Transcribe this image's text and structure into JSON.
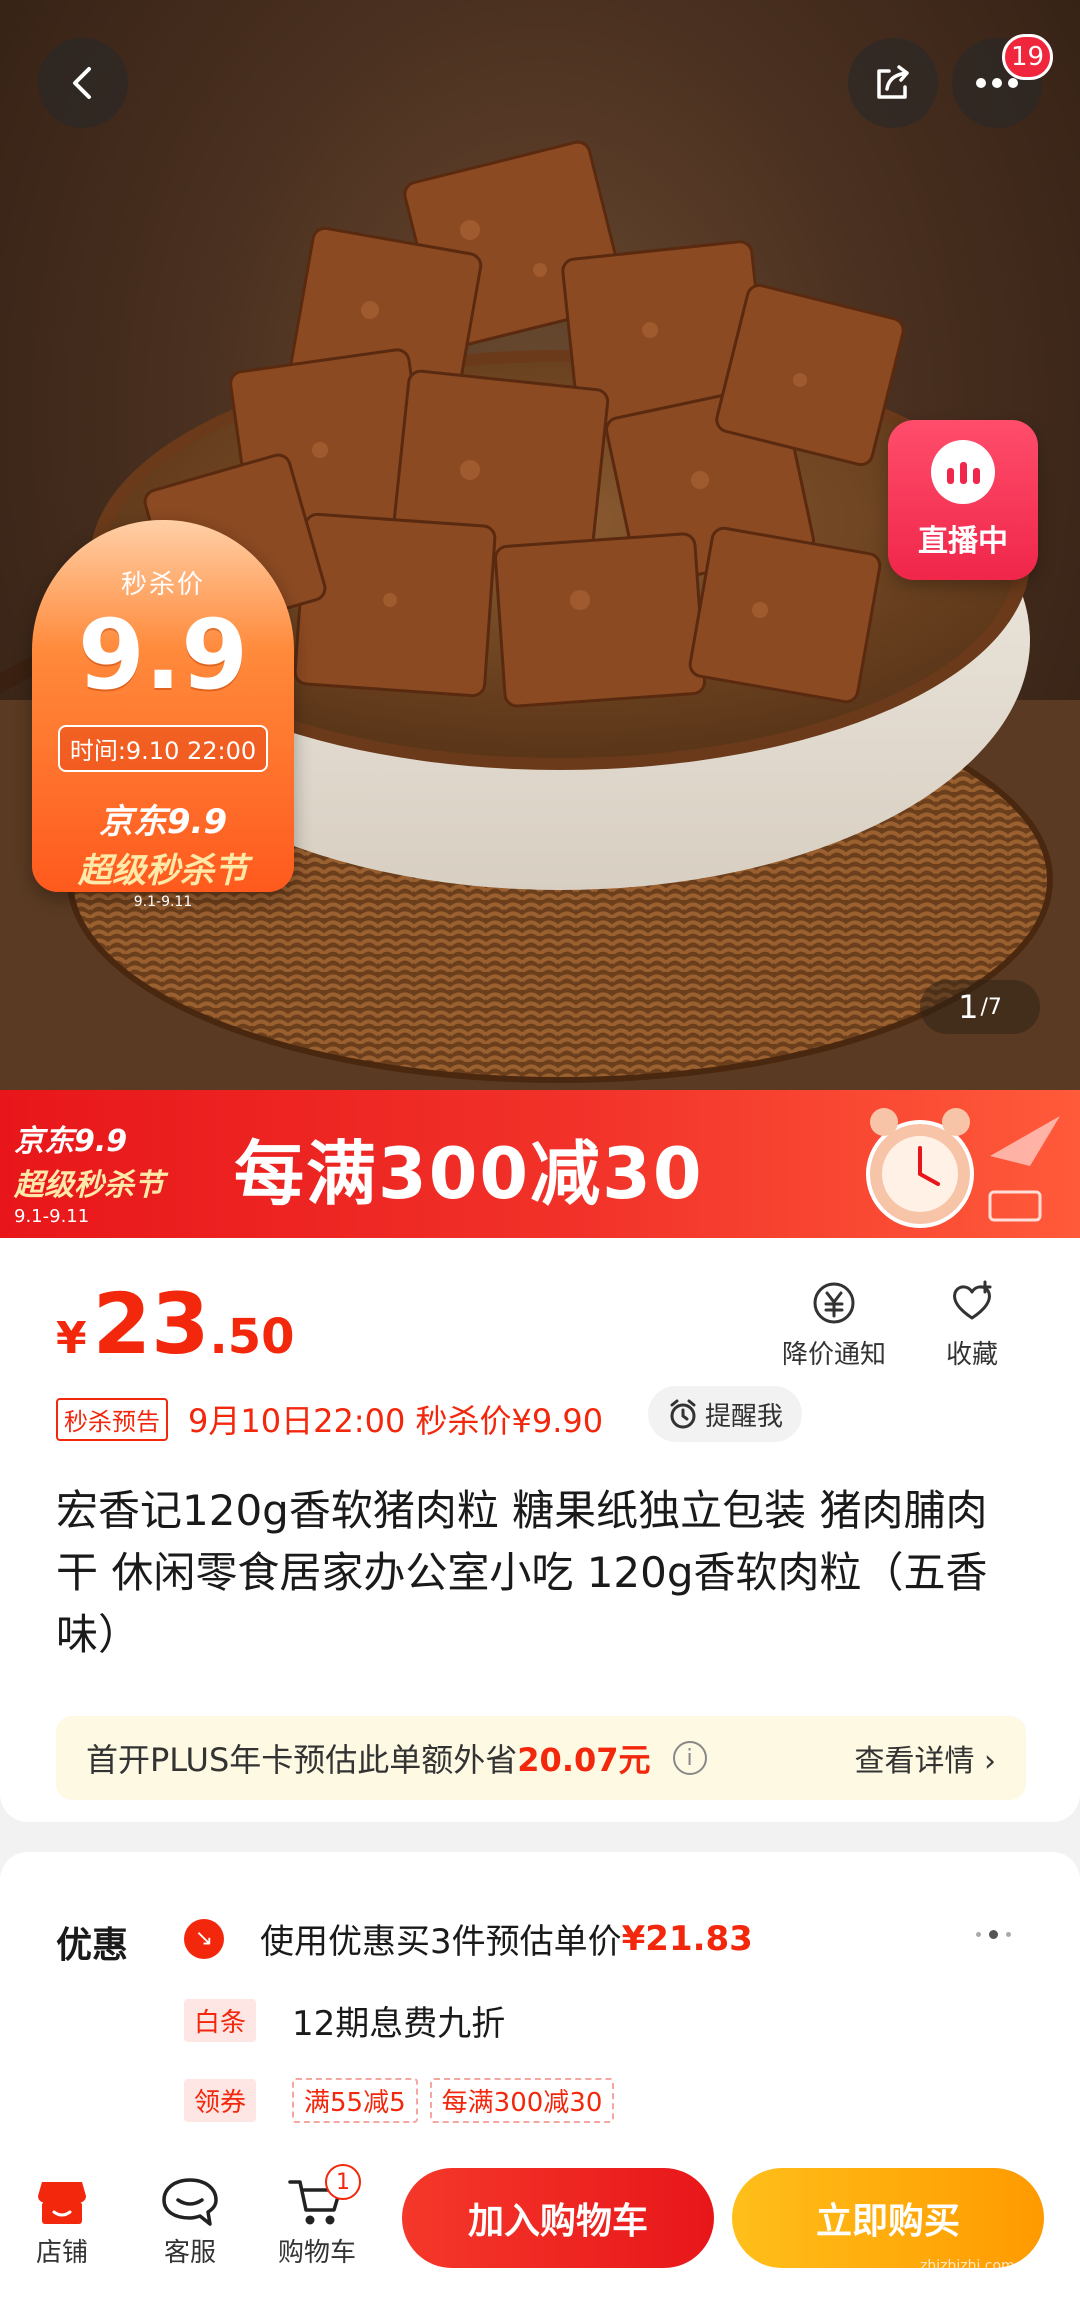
{
  "top_bar": {
    "notification_count": "19"
  },
  "hero": {
    "live_label": "直播中",
    "promo": {
      "label": "秒杀价",
      "price": "9.9",
      "time": "时间:9.10  22:00",
      "fest_line1": "京东9.9",
      "fest_line2": "超级秒杀节",
      "fest_dates": "9.1-9.11"
    },
    "image_index": "1",
    "image_total": "/7"
  },
  "banner": {
    "fest_line1": "京东9.9",
    "fest_line2": "超级秒杀节",
    "fest_dates": "9.1-9.11",
    "title": "每满300减30"
  },
  "product": {
    "currency": "¥",
    "price_int": "23",
    "price_dec": ".50",
    "price_alert_label": "降价通知",
    "favorite_label": "收藏",
    "preview_tag": "秒杀预告",
    "preview_text": "9月10日22:00 秒杀价¥9.90",
    "remind_label": "提醒我",
    "title": "宏香记120g香软猪肉粒 糖果纸独立包装 猪肉脯肉干 休闲零食居家办公室小吃 120g香软肉粒（五香味）",
    "plus_text": "首开PLUS年卡预估此单额外省",
    "plus_amount": "20.07元",
    "plus_detail": "查看详情 ›"
  },
  "offers": {
    "heading": "优惠",
    "row1_text": "使用优惠买3件预估单价",
    "row1_value": "¥21.83",
    "baitiao_tag": "白条",
    "baitiao_text": "12期息费九折",
    "coupon_tag": "领券",
    "coupons": [
      "满55减5",
      "每满300减30"
    ]
  },
  "bottom_bar": {
    "store_label": "店铺",
    "service_label": "客服",
    "cart_label": "购物车",
    "cart_count": "1",
    "add_to_cart": "加入购物车",
    "buy_now": "立即购买"
  },
  "watermark": "zhizhizhi.com",
  "colors": {
    "jd_red": "#f2270c",
    "buy_orange": "#ff9a00",
    "live_pink": "#f0264a"
  }
}
